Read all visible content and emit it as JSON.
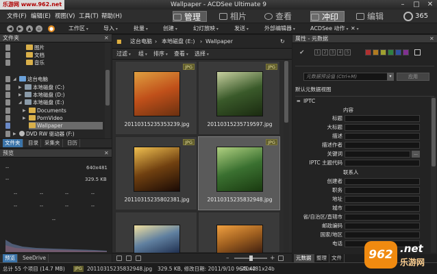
{
  "watermark": "乐游网 www.962.net",
  "window": {
    "title": "Wallpaper - ACDSee Ultimate 9",
    "minimize": "–",
    "maximize": "□",
    "close": "✕"
  },
  "menu": [
    "文件(F)",
    "编辑(E)",
    "视图(V)",
    "工具(T)",
    "帮助(H)"
  ],
  "modes": [
    {
      "label": "管理",
      "icon": "grid-icon"
    },
    {
      "label": "相片",
      "icon": "photo-icon"
    },
    {
      "label": "查看",
      "icon": "eye-icon"
    },
    {
      "label": "冲印",
      "icon": "develop-icon"
    },
    {
      "label": "编辑",
      "icon": "brush-icon"
    },
    {
      "label": "365",
      "icon": "cloud-icon"
    }
  ],
  "toolbar": [
    "工作区",
    "导入",
    "批量",
    "创建",
    "幻灯放映",
    "发送",
    "外部编辑器",
    "ACDSee 动作"
  ],
  "folders": {
    "title": "文件夹",
    "items": [
      {
        "label": "图片",
        "icon": "folder"
      },
      {
        "label": "文档",
        "icon": "folder"
      },
      {
        "label": "音乐",
        "icon": "folder"
      },
      {
        "label": "这台电脑",
        "icon": "pc"
      },
      {
        "label": "本地磁盘 (C:)",
        "icon": "drive"
      },
      {
        "label": "本地磁盘 (D:)",
        "icon": "drive"
      },
      {
        "label": "本地磁盘 (E:)",
        "icon": "drive"
      },
      {
        "label": "Documents",
        "icon": "folder"
      },
      {
        "label": "PornVideo",
        "icon": "folder"
      },
      {
        "label": "Wallpaper",
        "icon": "folder"
      },
      {
        "label": "DVD RW 驱动器 (F:)",
        "icon": "dvd"
      }
    ],
    "tabs": [
      "文件夹",
      "目录",
      "采集夹",
      "日历"
    ]
  },
  "preview": {
    "title": "预览",
    "width": "640x481",
    "size": "329.5 KB",
    "placeholder": "--",
    "tabs": [
      "预览",
      "SeeDrive"
    ]
  },
  "browser": {
    "crumbs": [
      "这台电脑",
      "本地磁盘 (E:)",
      "Wallpaper"
    ],
    "filters": [
      "过滤",
      "组",
      "排序",
      "查看",
      "选择"
    ],
    "badge": "JPG",
    "files": [
      {
        "name": "20110315235353239.jpg",
        "colors": [
          "#e0a040",
          "#c0501a",
          "#6a3010"
        ]
      },
      {
        "name": "20110315235719597.jpg",
        "colors": [
          "#c8d0a0",
          "#3a5a2a",
          "#1a2a10"
        ]
      },
      {
        "name": "20110315235802381.jpg",
        "colors": [
          "#f0c050",
          "#704010",
          "#1a0a05"
        ]
      },
      {
        "name": "20110315235832948.jpg",
        "colors": [
          "#b0d080",
          "#3a7030",
          "#1a3a10"
        ]
      },
      {
        "name": "",
        "colors": [
          "#f0e0a0",
          "#6080a0",
          "#203050"
        ]
      },
      {
        "name": "",
        "colors": [
          "#f0a040",
          "#a06020",
          "#402010"
        ]
      }
    ]
  },
  "properties": {
    "title": "属性 - 元数据",
    "labels": [
      "1",
      "2",
      "3",
      "4",
      "5"
    ],
    "colors": [
      "#b03030",
      "#b07a20",
      "#a0a030",
      "#308040",
      "#3050a0",
      "#803090",
      "#cccccc"
    ],
    "preset_placeholder": "元数据预设值 (Ctrl+M)",
    "apply": "应用",
    "view_select": "默认元数据视图",
    "group": "IPTC",
    "section_content": "内容",
    "fields_content": [
      "标题",
      "大标题",
      "描述",
      "描述作者",
      "关键词",
      "IPTC 主题代码"
    ],
    "section_contact": "联系人",
    "fields_contact": [
      "创建者",
      "职务",
      "地址",
      "城市",
      "省/自治区/直辖市",
      "邮政编码",
      "国家/地区",
      "电话"
    ],
    "tabs": [
      "元数据",
      "整理",
      "文件"
    ]
  },
  "status": {
    "total": "总计 55 个项目 (14.7 MB)",
    "file": "20110315235832948.jpg",
    "info": "329.5 KB, 修改日期: 2011/9/10 9:25:42",
    "dims": "640x481x24b"
  },
  "logo": {
    "badge": "962",
    "title": ".net",
    "subtitle": "乐游网"
  }
}
